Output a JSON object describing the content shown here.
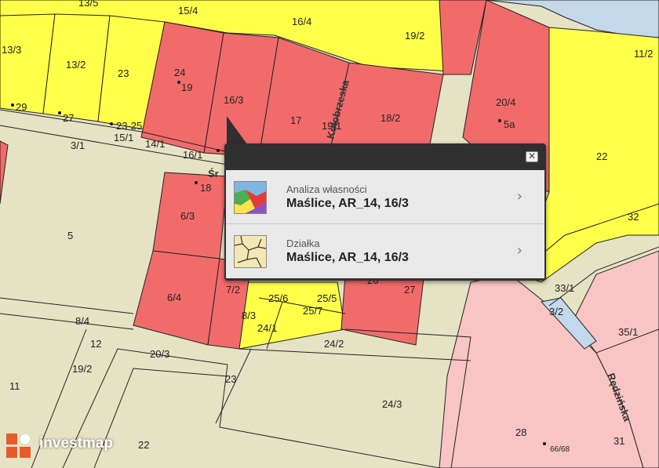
{
  "map": {
    "colors": {
      "background": "#e6e2c4",
      "yellow": "#ffff4a",
      "red": "#f26b6b",
      "pink": "#f9c4c4",
      "river": "#c3d8ea",
      "boundary": "#222222"
    },
    "parcel_labels": [
      "13/5",
      "15/4",
      "16/4",
      "19/2",
      "11/2",
      "13/3",
      "13/2",
      "23",
      "24",
      "16/3",
      "17",
      "19/1",
      "18/2",
      "20/4",
      "22",
      "29",
      "27",
      "23-25",
      "15/1",
      "14/1",
      "16/1",
      "19",
      "5a",
      "3/1",
      "5",
      "6/3",
      "18",
      "6/4",
      "7/2",
      "8/3",
      "25/6",
      "25/5",
      "25/7",
      "24/1",
      "24/2",
      "26",
      "27",
      "33/1",
      "3/2",
      "32",
      "8/4",
      "12",
      "20/3",
      "19/2",
      "11",
      "23",
      "24/3",
      "22",
      "28",
      "66/68",
      "31",
      "35/1"
    ],
    "street_labels": [
      "Kołobrzeska",
      "Śr",
      "Rędzińska"
    ]
  },
  "popup": {
    "close_glyph": "✕",
    "items": [
      {
        "caption": "Analiza własności",
        "title": "Maślice, AR_14, 16/3",
        "icon": "ownership-analysis-icon",
        "chevron": "›"
      },
      {
        "caption": "Działka",
        "title": "Maślice, AR_14, 16/3",
        "icon": "parcel-map-icon",
        "chevron": "›"
      }
    ]
  },
  "logo": {
    "text": "investmap",
    "color": "#e85a2a"
  }
}
